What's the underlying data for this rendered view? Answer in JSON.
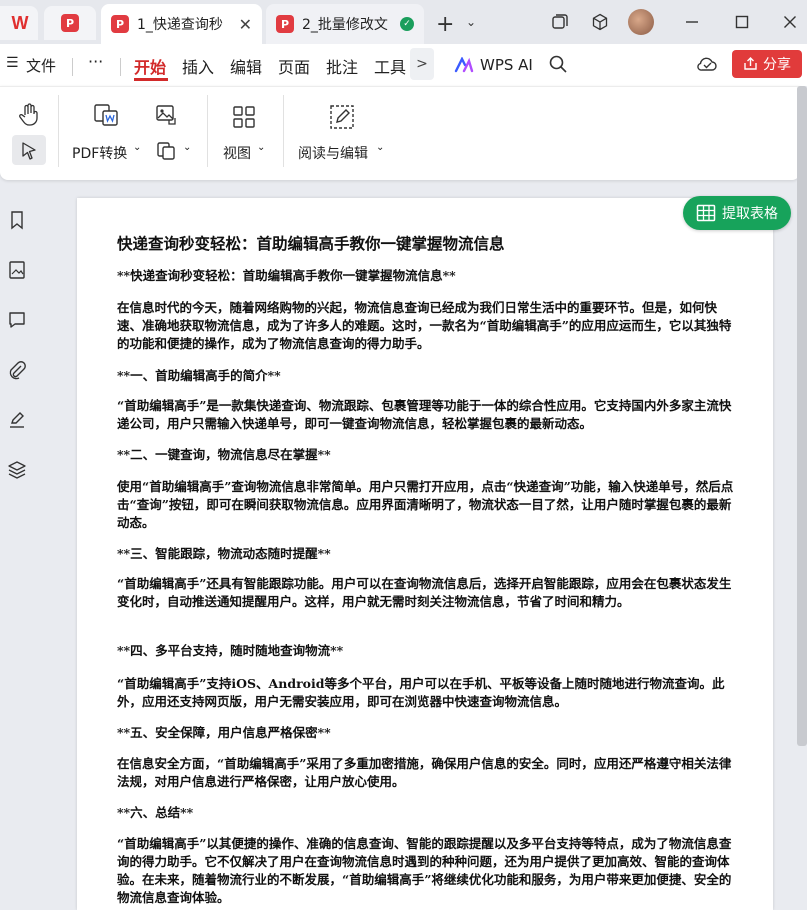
{
  "tabs": {
    "wps_logo": "W",
    "pdf_home": "P",
    "active_label": "1_快递查询秒",
    "inactive_label": "2_批量修改文",
    "new_tab": "+",
    "new_tab_dropdown": "⌄"
  },
  "menu": {
    "hamburger": "☰",
    "file": "文件",
    "more": "···",
    "items": [
      "开始",
      "插入",
      "编辑",
      "页面",
      "批注",
      "工具"
    ],
    "overflow": ">",
    "wps_ai": "WPS AI",
    "share": "分享"
  },
  "toolbar": {
    "pdf_convert": "PDF转换",
    "view": "视图",
    "read_edit": "阅读与编辑"
  },
  "extract_table": "提取表格",
  "document": {
    "title": "快递查询秒变轻松：首助编辑高手教你一键掌握物流信息",
    "paragraphs": [
      "**快递查询秒变轻松：首助编辑高手教你一键掌握物流信息**",
      "在信息时代的今天，随着网络购物的兴起，物流信息查询已经成为我们日常生活中的重要环节。但是，如何快速、准确地获取物流信息，成为了许多人的难题。这时，一款名为“首助编辑高手”的应用应运而生，它以其独特的功能和便捷的操作，成为了物流信息查询的得力助手。",
      "**一、首助编辑高手的简介**",
      "“首助编辑高手”是一款集快递查询、物流跟踪、包裹管理等功能于一体的综合性应用。它支持国内外多家主流快递公司，用户只需输入快递单号，即可一键查询物流信息，轻松掌握包裹的最新动态。",
      "**二、一键查询，物流信息尽在掌握**",
      "使用“首助编辑高手”查询物流信息非常简单。用户只需打开应用，点击“快递查询”功能，输入快递单号，然后点击“查询”按钮，即可在瞬间获取物流信息。应用界面清晰明了，物流状态一目了然，让用户随时掌握包裹的最新动态。",
      "**三、智能跟踪，物流动态随时提醒**",
      "“首助编辑高手”还具有智能跟踪功能。用户可以在查询物流信息后，选择开启智能跟踪，应用会在包裹状态发生变化时，自动推送通知提醒用户。这样，用户就无需时刻关注物流信息，节省了时间和精力。",
      "**四、多平台支持，随时随地查询物流**",
      "“首助编辑高手”支持iOS、Android等多个平台，用户可以在手机、平板等设备上随时随地进行物流查询。此外，应用还支持网页版，用户无需安装应用，即可在浏览器中快速查询物流信息。",
      "**五、安全保障，用户信息严格保密**",
      "在信息安全方面，“首助编辑高手”采用了多重加密措施，确保用户信息的安全。同时，应用还严格遵守相关法律法规，对用户信息进行严格保密，让用户放心使用。",
      "**六、总结**",
      "“首助编辑高手”以其便捷的操作、准确的信息查询、智能的跟踪提醒以及多平台支持等特点，成为了物流信息查询的得力助手。它不仅解决了用户在查询物流信息时遇到的种种问题，还为用户提供了更加高效、智能的查询体验。在未来，随着物流行业的不断发展，“首助编辑高手”将继续优化功能和服务，为用户带来更加便捷、安全的物流信息查询体验。"
    ]
  },
  "colors": {
    "accent_red": "#d22a2a",
    "share_red": "#e13b3b",
    "extract_green": "#17a35b"
  }
}
